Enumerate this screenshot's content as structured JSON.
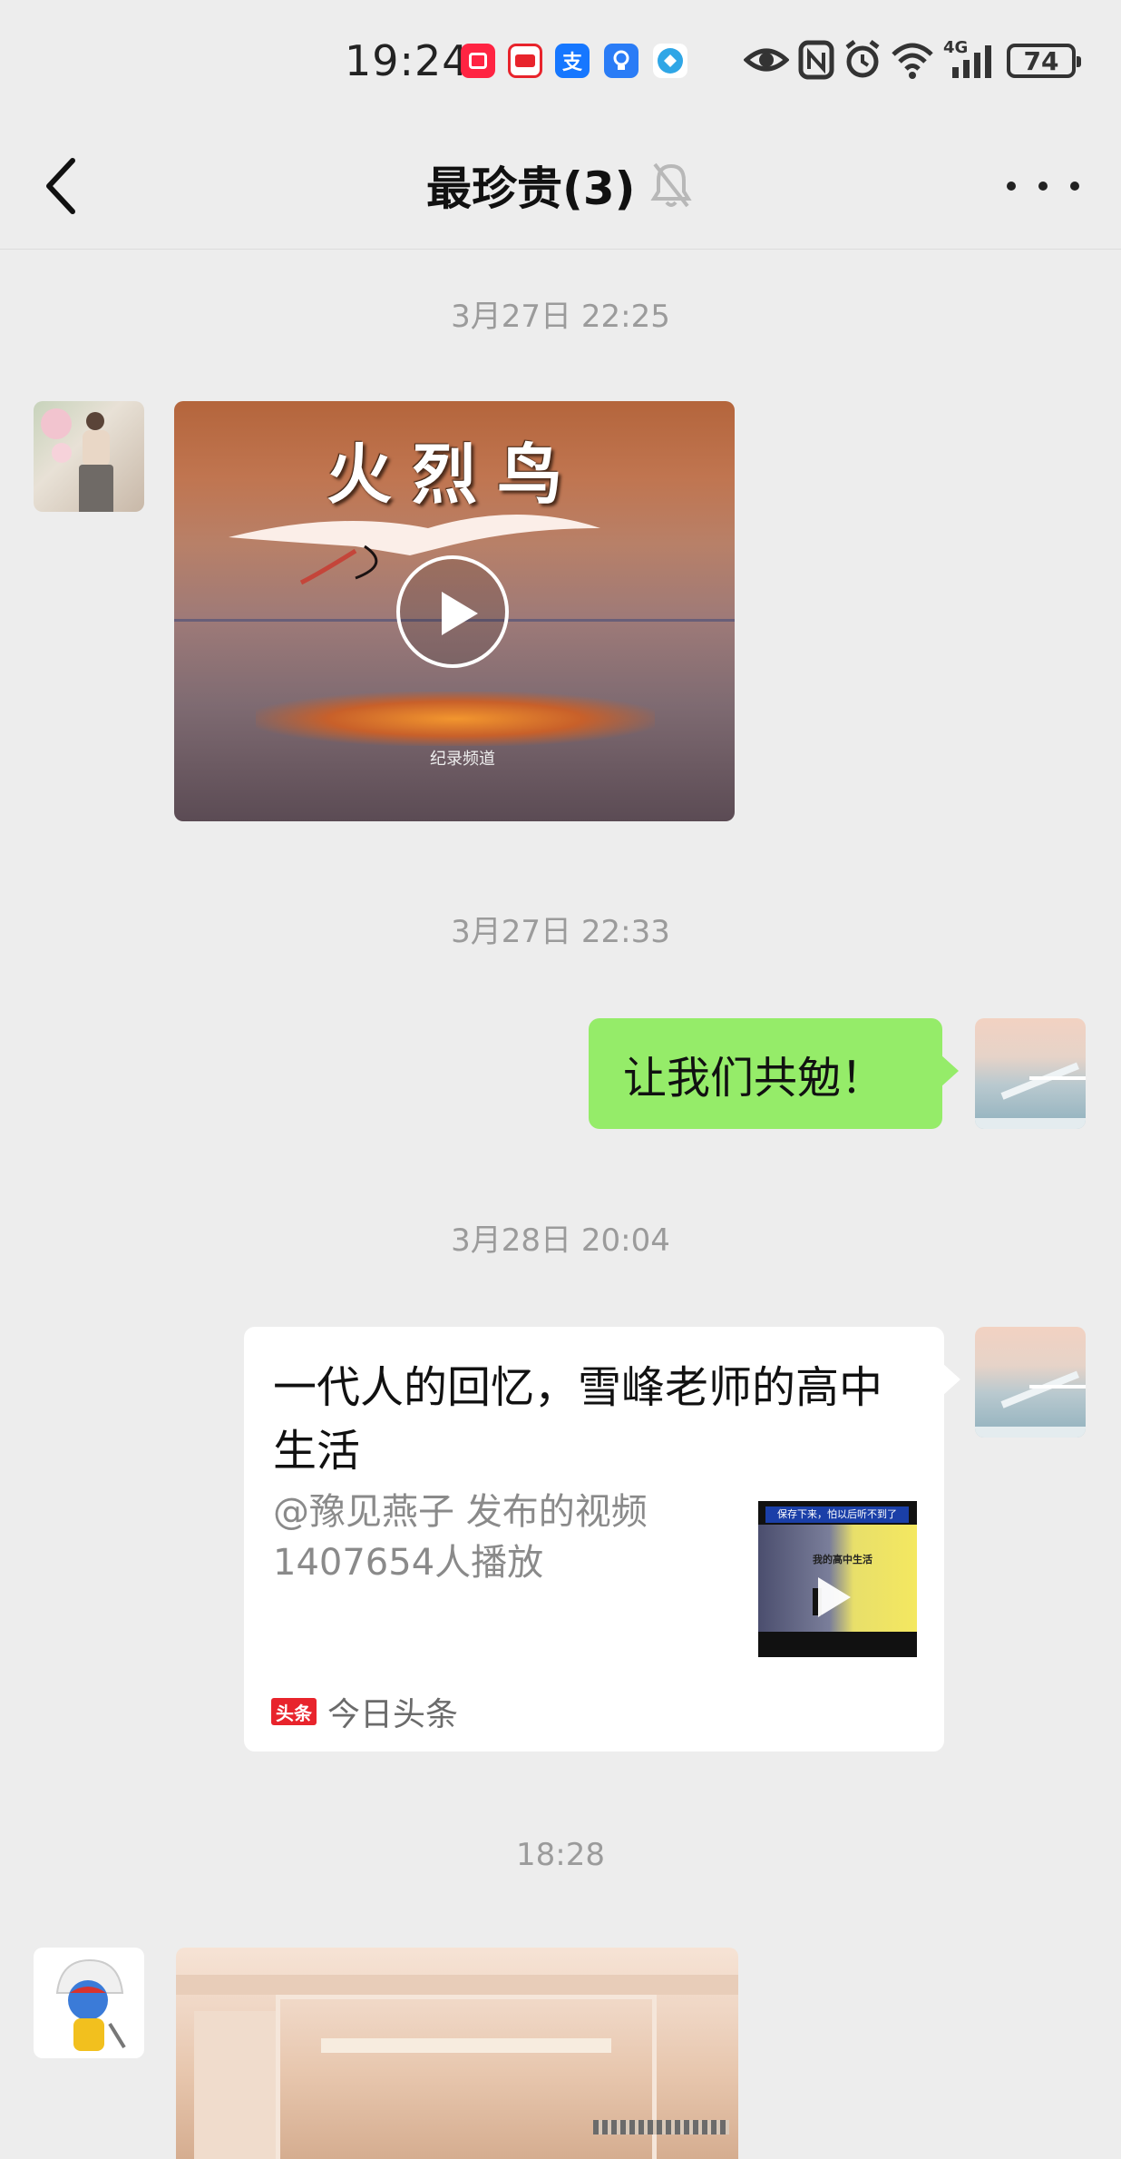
{
  "status_bar": {
    "time": "19:24",
    "apps": [
      {
        "name": "xiaohongshu-icon",
        "color": "#ff2442"
      },
      {
        "name": "news-icon",
        "color": "#e8242c"
      },
      {
        "name": "alipay-icon",
        "color": "#1677ff",
        "glyph": "支"
      },
      {
        "name": "bulb-app-icon",
        "color": "#2a7cf6"
      },
      {
        "name": "browser-icon",
        "color": "#2fa6e6"
      }
    ],
    "battery": "74",
    "network": "4G"
  },
  "nav": {
    "title": "最珍贵(3)",
    "back_icon": "chevron-left-icon",
    "mute_icon": "bell-off-icon",
    "more_icon": "more-horizontal-icon"
  },
  "messages": [
    {
      "timestamp": "3月27日 22:25",
      "type": "video",
      "side": "left",
      "video_title": "火烈鸟",
      "video_channel": "纪录频道"
    },
    {
      "timestamp": "3月27日 22:33",
      "type": "text",
      "side": "right",
      "text": "让我们共勉！"
    },
    {
      "timestamp": "3月28日 20:04",
      "type": "link",
      "side": "right",
      "title": "一代人的回忆，雪峰老师的高中生活",
      "desc_line1": "@豫见燕子 发布的视频",
      "desc_line2": "1407654人播放",
      "thumb_banner": "保存下来，怕以后听不到了",
      "thumb_sub": "我的高中生活",
      "source_logo": "头条",
      "source_name": "今日头条"
    },
    {
      "timestamp": "18:28",
      "type": "image",
      "side": "left"
    }
  ],
  "colors": {
    "background": "#ededed",
    "bubble_green": "#95ec69",
    "timestamp_gray": "#9b9b9b"
  }
}
